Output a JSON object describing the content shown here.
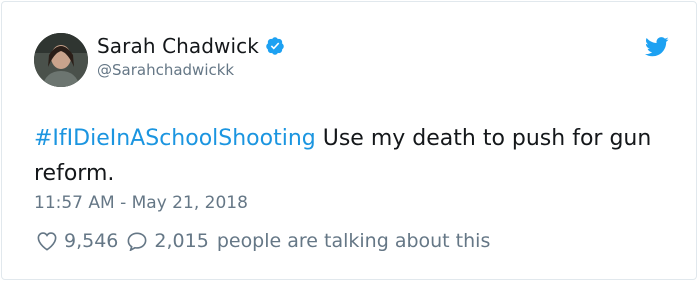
{
  "tweet": {
    "author_name": "Sarah Chadwick",
    "author_handle": "@Sarahchadwickk",
    "hashtag": "#IfIDieInASchoolShooting",
    "text": " Use my death to push for gun reform.",
    "timestamp": "11:57 AM - May 21, 2018",
    "like_count": "9,546",
    "reply_count": "2,015",
    "talking_text": "people are talking about this"
  },
  "colors": {
    "link": "#1b95e0",
    "twitter_blue": "#1da1f2",
    "secondary_text": "#657786",
    "primary_text": "#14171a"
  },
  "icons": [
    "avatar",
    "verified-badge-icon",
    "twitter-bird-icon",
    "heart-icon",
    "reply-bubble-icon"
  ]
}
